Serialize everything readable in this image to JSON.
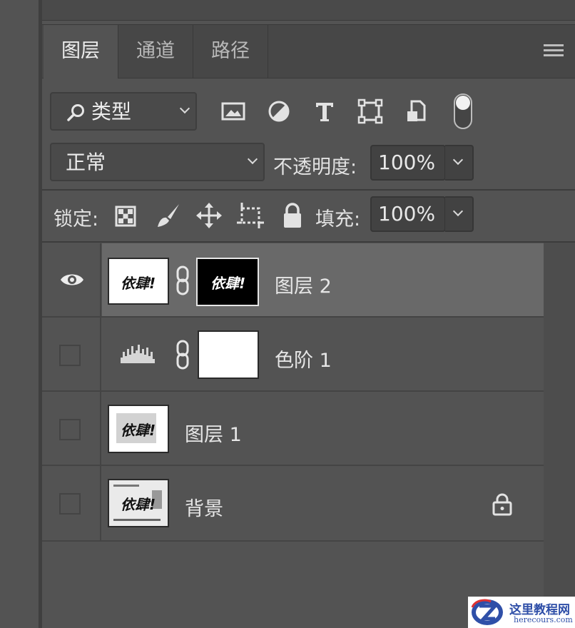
{
  "tabs": [
    {
      "label": "图层",
      "active": true
    },
    {
      "label": "通道",
      "active": false
    },
    {
      "label": "路径",
      "active": false
    }
  ],
  "filter": {
    "label": "类型",
    "icons": [
      "image-filter-icon",
      "adjustment-filter-icon",
      "type-filter-icon",
      "shape-filter-icon",
      "smart-object-filter-icon",
      "filter-toggle-switch"
    ]
  },
  "blend": {
    "mode": "正常",
    "opacity_label": "不透明度:",
    "opacity_value": "100%"
  },
  "lock": {
    "label": "锁定:",
    "fill_label": "填充:",
    "fill_value": "100%"
  },
  "layers": [
    {
      "name": "图层 2",
      "visible": true,
      "selected": true,
      "thumb_text": "依肆!",
      "mask_text": "依肆!"
    },
    {
      "name": "色阶 1",
      "visible": false,
      "selected": false
    },
    {
      "name": "图层 1",
      "visible": false,
      "selected": false,
      "thumb_text": "依肆!"
    },
    {
      "name": "背景",
      "visible": false,
      "selected": false,
      "locked": true,
      "thumb_text": "依肆!"
    }
  ],
  "watermark": {
    "title": "这里教程网",
    "url": "herecours.com"
  },
  "colors": {
    "panel_bg": "#535353",
    "selected_row": "#696969",
    "tab_bar": "#474747"
  }
}
